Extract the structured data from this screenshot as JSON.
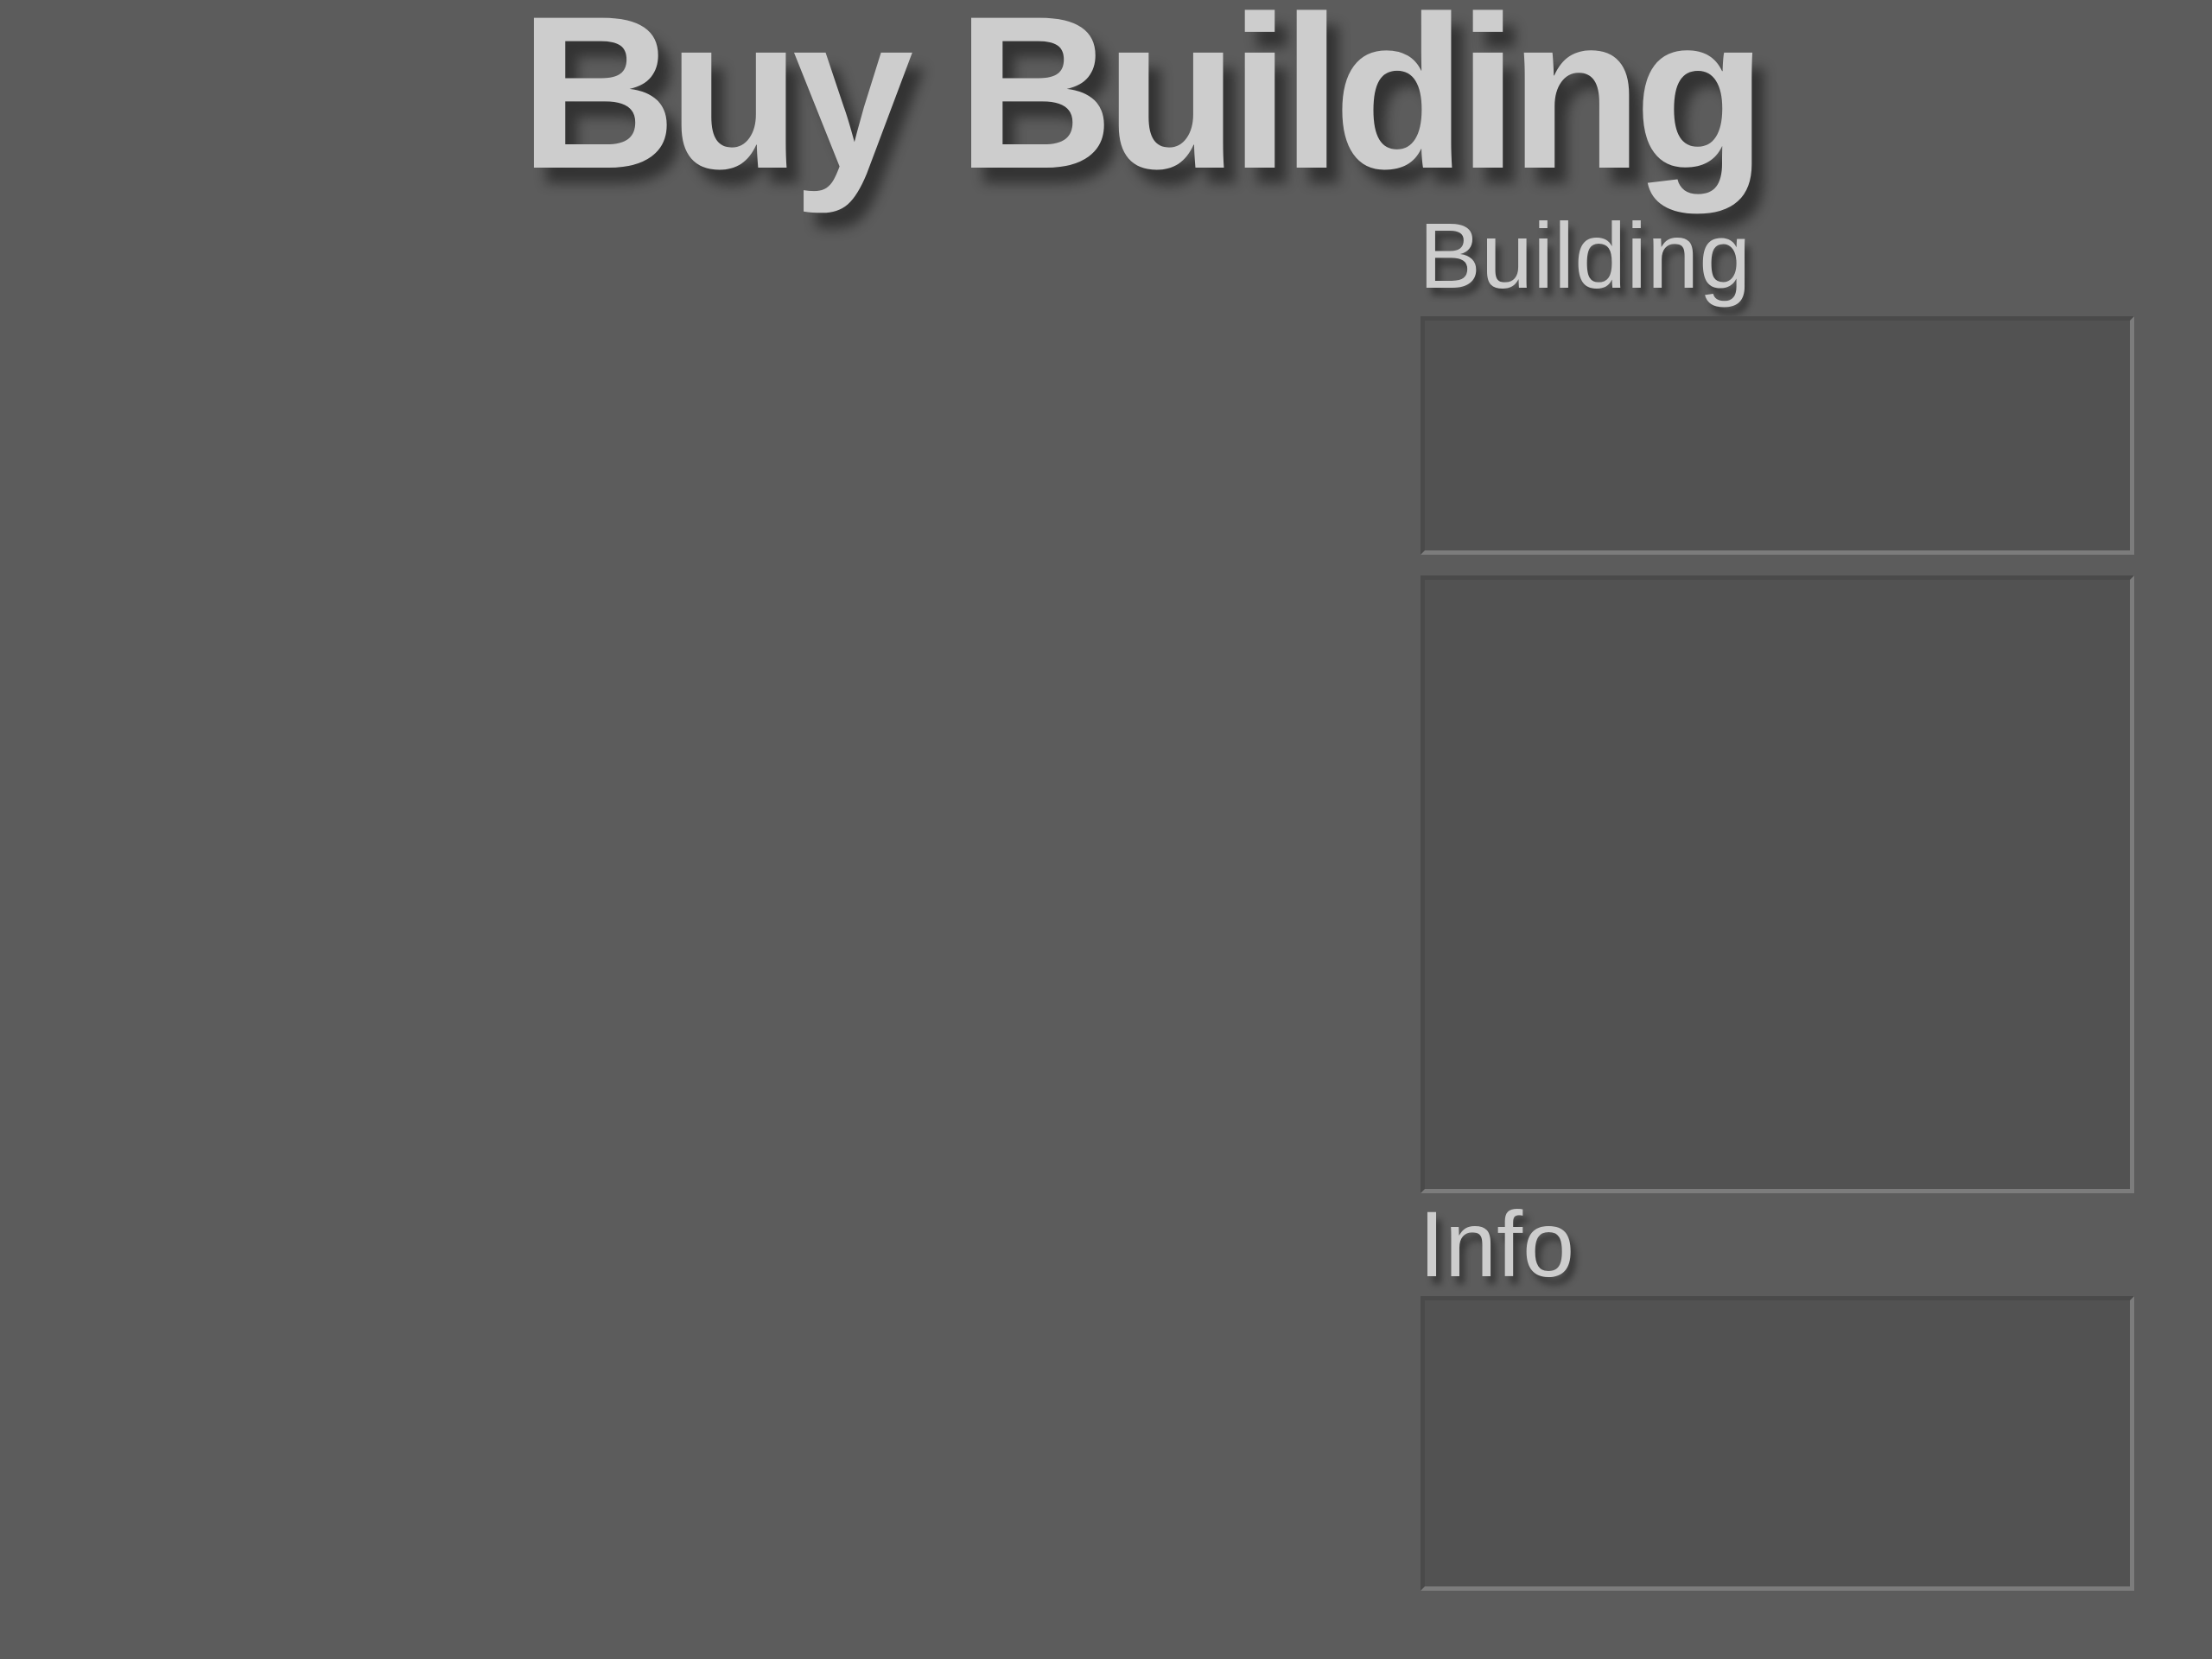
{
  "screen": {
    "title": "Buy Building"
  },
  "building_section": {
    "label": "Building"
  },
  "info_section": {
    "label": "Info"
  },
  "colors": {
    "background": "#5c5c5c",
    "panel": "#525252",
    "text": "#cdcdcd"
  }
}
